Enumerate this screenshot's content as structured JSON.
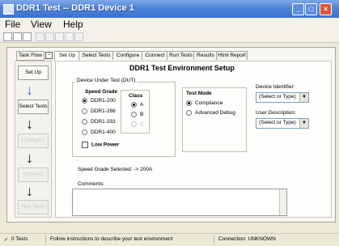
{
  "window": {
    "title": "DDR1 Test -- DDR1 Device 1",
    "minimize_label": "_",
    "maximize_label": "□",
    "close_label": "×"
  },
  "menubar": {
    "items": [
      "File",
      "View",
      "Help"
    ]
  },
  "task_flow": {
    "header": "Task Flow",
    "steps": [
      {
        "label": "Set Up",
        "enabled": true
      },
      {
        "label": "Select Tests",
        "enabled": true
      },
      {
        "label": "Configure",
        "enabled": false
      },
      {
        "label": "Connect",
        "enabled": false
      },
      {
        "label": "Run Tests",
        "enabled": false
      }
    ]
  },
  "tabs": [
    "Set Up",
    "Select Tests",
    "Configure",
    "Connect",
    "Run Tests",
    "Results",
    "Html Report"
  ],
  "active_tab": "Set Up",
  "setup": {
    "title": "DDR1 Test Environment Setup",
    "dut_label": "Device Under Test (DUT)",
    "speed_grade": {
      "label": "Speed Grade",
      "options": [
        "DDR1-200",
        "DDR1-266",
        "DDR1-333",
        "DDR1-400"
      ],
      "selected": "DDR1-200"
    },
    "class": {
      "label": "Class",
      "options": [
        "A",
        "B",
        "C"
      ],
      "selected": "A",
      "disabled": [
        "C"
      ]
    },
    "low_power_label": "Low Power",
    "test_mode": {
      "label": "Test Mode",
      "options": [
        "Compliance",
        "Advanced Debug"
      ],
      "selected": "Compliance"
    },
    "device_identifier": {
      "label": "Device Identifier:",
      "value": "(Select or Type)"
    },
    "user_description": {
      "label": "User Description:",
      "value": "(Select or Type)"
    },
    "speed_grade_selected": "Speed Grade Selected: -> 200A",
    "comments_label": "Comments:",
    "comments_value": ""
  },
  "status": {
    "tests": "0 Tests",
    "message": "Follow instructions to describe your test environment",
    "connection": "Connection: UNKNOWN"
  }
}
